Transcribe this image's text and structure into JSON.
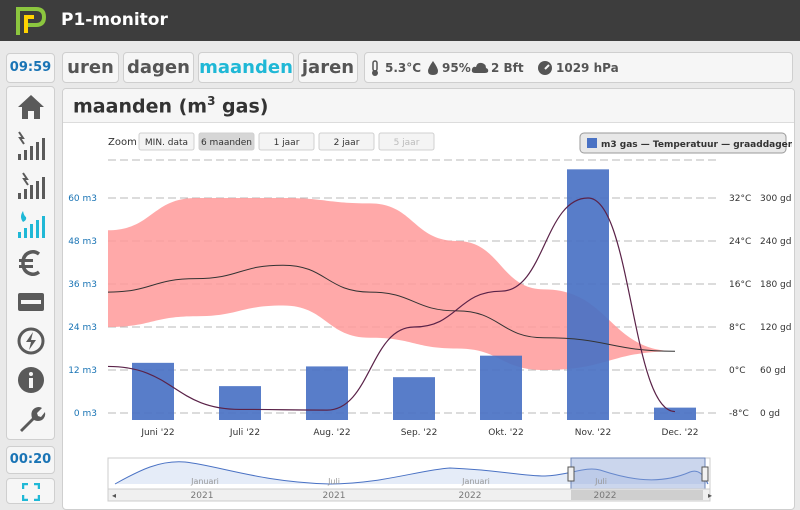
{
  "app": {
    "title": "P1-monitor",
    "clock": "09:59",
    "refresh_counter": "00:20"
  },
  "sidebar": {
    "items": [
      "home-icon",
      "power-meter-icon",
      "power-phases-icon",
      "gas-meter-icon",
      "euro-icon",
      "card-icon",
      "power-status-icon",
      "info-icon",
      "wrench-icon"
    ],
    "active": "gas-meter-icon",
    "accent": "#1fb8d6"
  },
  "tabs": [
    {
      "label": "uren"
    },
    {
      "label": "dagen"
    },
    {
      "label": "maanden",
      "active": true
    },
    {
      "label": "jaren"
    }
  ],
  "weather": {
    "temperature": "5.3°C",
    "humidity": "95%",
    "wind": "2 Bft",
    "pressure": "1029 hPa"
  },
  "panel": {
    "title_main": "maanden (m",
    "title_sup": "3",
    "title_end": " gas)"
  },
  "zoom": {
    "label": "Zoom",
    "buttons": [
      "MIN. data",
      "6 maanden",
      "1 jaar",
      "2 jaar",
      "5 jaar"
    ],
    "active": "6 maanden"
  },
  "legend": {
    "text": "m3 gas — Temperatuur — graaddagen"
  },
  "chart_data": {
    "type": "bar",
    "categories": [
      "Juni '22",
      "Juli '22",
      "Aug. '22",
      "Sep. '22",
      "Okt. '22",
      "Nov. '22",
      "Dec. '22"
    ],
    "series": [
      {
        "name": "m3 gas",
        "values": [
          14,
          7.5,
          13,
          10,
          16,
          68,
          1.5
        ],
        "color": "#4a72c4"
      },
      {
        "name": "Temperatuur",
        "type": "line",
        "axis": "temperature",
        "values": [
          14.5,
          17,
          19.5,
          14.5,
          11,
          6,
          3.5
        ],
        "range_min": [
          8,
          10,
          12,
          6,
          4,
          0,
          3.5
        ],
        "range_max": [
          26,
          32,
          32,
          31,
          24,
          15,
          3.5
        ],
        "color": "#333333",
        "band_color": "#ff9a9a"
      },
      {
        "name": "graaddagen",
        "type": "line",
        "axis": "graaddagen",
        "values": [
          65,
          5,
          4,
          120,
          170,
          300,
          2
        ],
        "color": "#5a2248"
      }
    ],
    "y_left": {
      "ticks": [
        "60 m3",
        "48 m3",
        "36 m3",
        "24 m3",
        "12 m3",
        "0 m3"
      ],
      "ylim": [
        0,
        60
      ]
    },
    "y_temp": {
      "ticks": [
        "32°C",
        "24°C",
        "16°C",
        "8°C",
        "0°C",
        "-8°C"
      ],
      "ylim": [
        -8,
        32
      ]
    },
    "y_gd": {
      "ticks": [
        "300 gd",
        "240 gd",
        "180 gd",
        "120 gd",
        "60 gd",
        "0 gd"
      ],
      "ylim": [
        0,
        300
      ]
    },
    "navigator": {
      "month_labels": [
        "Januari",
        "Juli",
        "Januari",
        "Juli"
      ],
      "year_labels": [
        "2021",
        "2021",
        "2022",
        "2022"
      ]
    }
  }
}
